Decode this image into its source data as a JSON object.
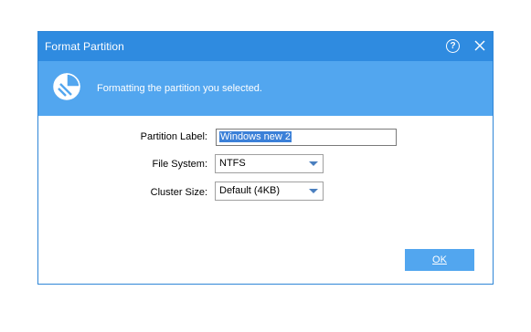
{
  "dialog": {
    "title": "Format Partition",
    "help_symbol": "?",
    "banner_text": "Formatting the partition you selected."
  },
  "form": {
    "partition_label": {
      "label": "Partition Label:",
      "value": "Windows new 2"
    },
    "file_system": {
      "label": "File System:",
      "value": "NTFS"
    },
    "cluster_size": {
      "label": "Cluster Size:",
      "value": "Default (4KB)"
    }
  },
  "buttons": {
    "ok_label": "OK"
  },
  "colors": {
    "titlebar": "#2f8be0",
    "banner": "#52a6ef",
    "accent": "#52a6ef",
    "selection": "#3b80d8"
  },
  "icons": {
    "help": "help-icon",
    "close": "close-icon",
    "banner": "disk-format-icon",
    "dropdown": "chevron-down-icon"
  }
}
